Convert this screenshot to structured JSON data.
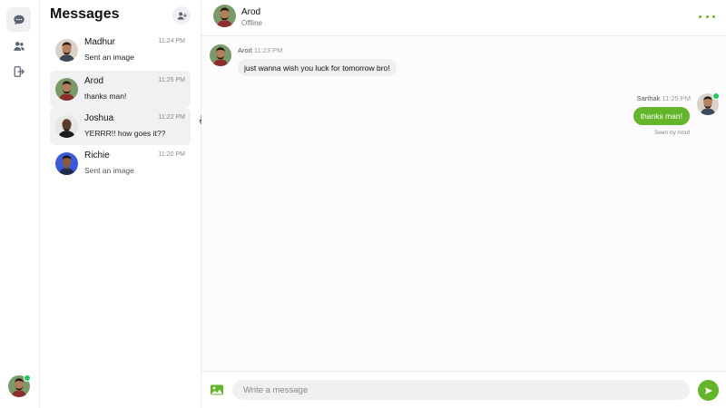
{
  "colors": {
    "accent": "#65b52b",
    "online": "#22c55e",
    "selected_row": "#f1f1f3",
    "incoming_bubble": "#efeff1"
  },
  "rail": {
    "items": [
      {
        "icon": "chat-bubble-icon",
        "active": true
      },
      {
        "icon": "users-icon",
        "active": false
      },
      {
        "icon": "logout-icon",
        "active": false
      }
    ],
    "current_user": {
      "avatar": "avatar",
      "online": true
    }
  },
  "sidebar": {
    "title": "Messages",
    "new_chat_icon": "add-user-icon",
    "conversations": [
      {
        "name": "Madhur",
        "time": "11:24 PM",
        "preview": "Sent an image",
        "selected": false,
        "unread": true
      },
      {
        "name": "Arod",
        "time": "11:25 PM",
        "preview": "thanks man!",
        "selected": true,
        "unread": false
      },
      {
        "name": "Joshua",
        "time": "11:22 PM",
        "preview": "YERRR!! how goes it??",
        "selected": true,
        "unread": true
      },
      {
        "name": "Richie",
        "time": "11:20 PM",
        "preview": "Sent an image",
        "selected": false,
        "unread": false
      }
    ]
  },
  "chat": {
    "contact_name": "Arod",
    "contact_status": "Offline",
    "more_icon": "more-dots-icon",
    "messages": [
      {
        "direction": "incoming",
        "sender": "Arod",
        "time": "11:23 PM",
        "text": "just wanna wish you luck for tomorrow bro!"
      },
      {
        "direction": "outgoing",
        "sender": "Sarthak",
        "time": "11:25 PM",
        "text": "thanks man!",
        "receipt": "Seen by Arod"
      }
    ],
    "composer": {
      "placeholder": "Write a message",
      "value": "",
      "attach_icon": "image-icon",
      "send_icon": "send-icon"
    }
  }
}
